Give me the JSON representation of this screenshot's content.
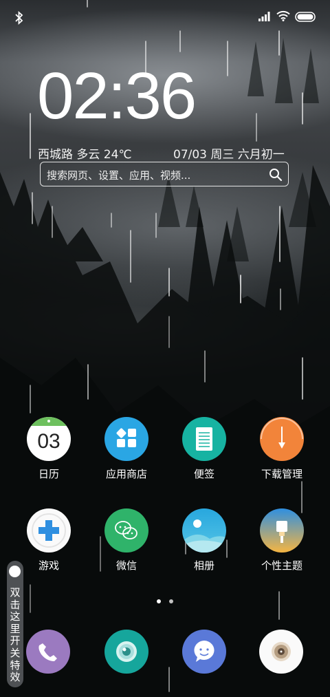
{
  "status_bar": {
    "icons": [
      "bluetooth-icon",
      "signal-icon",
      "wifi-icon",
      "battery-icon"
    ]
  },
  "lockscreen": {
    "time": "02:36",
    "location_weather": "西城路  多云  24℃",
    "date_line": "07/03  周三  六月初一"
  },
  "search": {
    "placeholder": "搜索网页、设置、应用、视频..."
  },
  "apps": {
    "calendar": {
      "label": "日历",
      "day": "03"
    },
    "app_store": {
      "label": "应用商店"
    },
    "notes": {
      "label": "便签"
    },
    "downloads": {
      "label": "下载管理"
    },
    "games": {
      "label": "游戏"
    },
    "wechat": {
      "label": "微信"
    },
    "gallery": {
      "label": "相册"
    },
    "themes": {
      "label": "个性主题"
    }
  },
  "pager": {
    "pages": 2,
    "current": 1
  },
  "effect_toggle": {
    "label": "双击这里开关特效"
  },
  "dock": {
    "icons": [
      "phone-icon",
      "camera-icon",
      "messages-icon",
      "music-icon"
    ]
  },
  "colors": {
    "calendar_green": "#6dc05e",
    "app_store_blue": "#2aa6e4",
    "notes_teal": "#17b3a2",
    "downloads_orange": "#f2843a",
    "wechat_green": "#2fb36a",
    "phone_purple": "#9b7ac0",
    "camera_teal": "#16a69c",
    "messages_blue": "#5a79d8"
  }
}
